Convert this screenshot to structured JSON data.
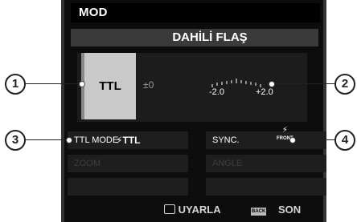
{
  "header": {
    "title": "MOD",
    "subtitle": "DAHİLİ FLAŞ"
  },
  "flash": {
    "mode": "TTL",
    "compensation": "±0",
    "scale_min": "-2.0",
    "scale_max": "+2.0"
  },
  "settings": {
    "ttl_mode_label": "TTL MODE",
    "ttl_mode_value": "TTL",
    "sync_label": "SYNC.",
    "sync_value": "FRONT",
    "zoom_label": "ZOOM",
    "angle_label": "ANGLE"
  },
  "footer": {
    "adjust_label": "UYARLA",
    "back_icon_label": "BACK",
    "end_label": "SON"
  },
  "callouts": [
    "1",
    "2",
    "3",
    "4"
  ]
}
